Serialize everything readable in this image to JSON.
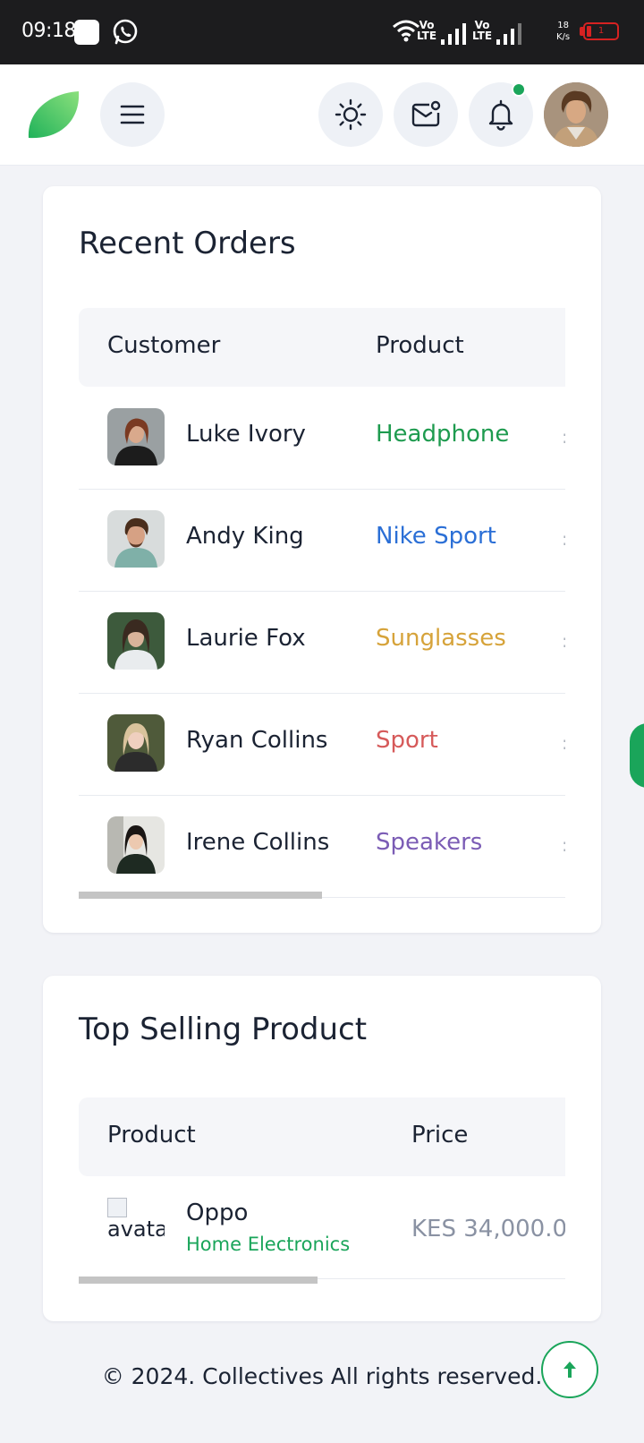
{
  "status_bar": {
    "time": "09:18",
    "volte1": "Vo\nLTE",
    "volte2": "Vo\nLTE",
    "speed": "18\nK/s",
    "battery": "1"
  },
  "header": {
    "logo_icon": "leaf-logo-icon",
    "menu_icon": "hamburger-menu-icon",
    "theme_icon": "sun-icon",
    "mail_icon": "mail-icon",
    "bell_icon": "bell-icon",
    "notification_dot_color": "#1aa55a"
  },
  "recent_orders": {
    "title": "Recent Orders",
    "columns": [
      "Customer",
      "Product"
    ],
    "rows": [
      {
        "customer": "Luke Ivory",
        "product": "Headphone",
        "product_color": "#1e9b4f"
      },
      {
        "customer": "Andy King",
        "product": "Nike Sport",
        "product_color": "#2b6fd6"
      },
      {
        "customer": "Laurie Fox",
        "product": "Sunglasses",
        "product_color": "#d6a33a"
      },
      {
        "customer": "Ryan Collins",
        "product": "Sport",
        "product_color": "#d65a5a"
      },
      {
        "customer": "Irene Collins",
        "product": "Speakers",
        "product_color": "#7b5cb5"
      }
    ],
    "scroll_fraction": 0.5
  },
  "top_selling": {
    "title": "Top Selling Product",
    "columns": [
      "Product",
      "Price"
    ],
    "rows": [
      {
        "image_alt": "avatar",
        "name": "Oppo",
        "category": "Home Electronics",
        "price": "KES 34,000.0"
      }
    ],
    "scroll_fraction": 0.49
  },
  "footer": {
    "text": "© 2024. Collectives All rights reserved.",
    "back_to_top_icon": "arrow-up-icon"
  }
}
